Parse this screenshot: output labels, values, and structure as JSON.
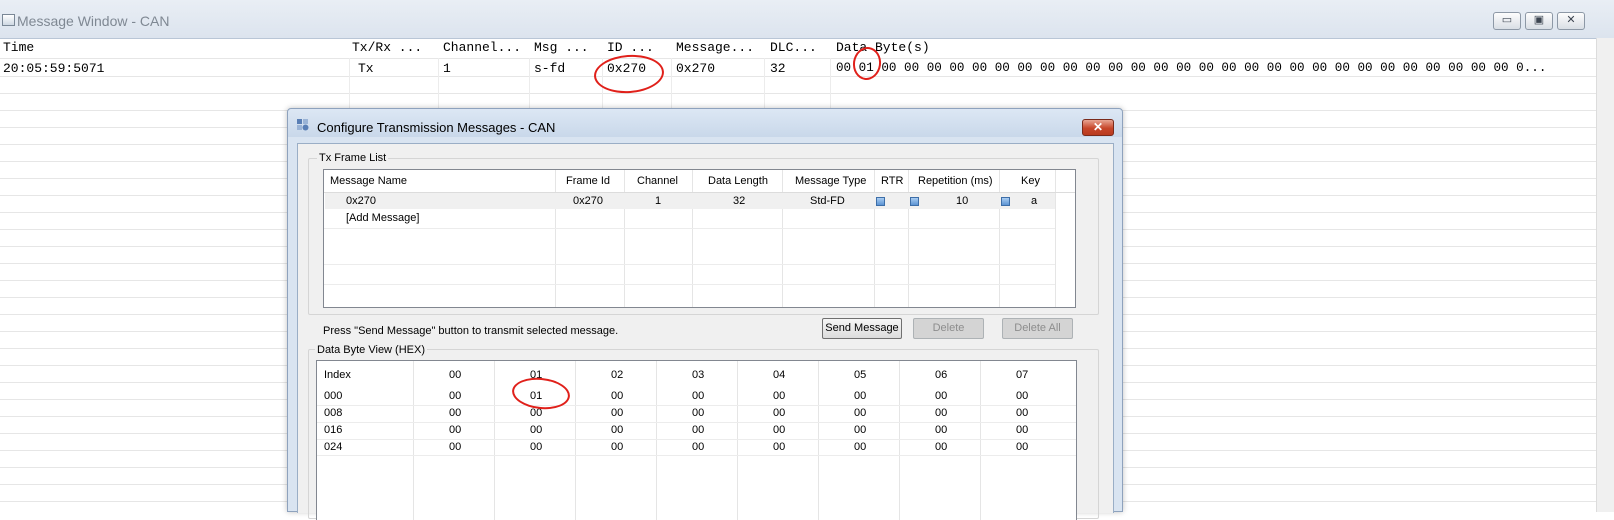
{
  "message_window": {
    "title": "Message Window - CAN",
    "buttons": {
      "minimize": "▭",
      "restore": "▣",
      "close": "✕"
    },
    "columns": [
      "Time",
      "Tx/Rx ...",
      "Channel...",
      "Msg ...",
      "ID  ...",
      "Message...",
      "DLC...",
      "Data Byte(s)"
    ],
    "row": {
      "time": "20:05:59:5071",
      "txrx": "Tx",
      "channel": "1",
      "msg_type": "s-fd",
      "id": "0x270",
      "message": "0x270",
      "dlc": "32",
      "data_bytes": "00 01 00 00 00 00 00 00 00 00 00 00 00 00 00 00 00 00 00 00 00 00 00 00 00 00 00 00 00 00 0..."
    }
  },
  "dialog": {
    "title": "Configure Transmission Messages - CAN",
    "close_label": "✕",
    "tx_frame_list": {
      "label": "Tx Frame List",
      "columns": [
        "Message Name",
        "Frame Id",
        "Channel",
        "Data Length",
        "Message Type",
        "RTR",
        "Repetition (ms)",
        "Key"
      ],
      "rows": [
        {
          "name": "0x270",
          "frame_id": "0x270",
          "channel": "1",
          "data_length": "32",
          "message_type": "Std-FD",
          "repetition": "10",
          "key": "a"
        }
      ],
      "add_message": "[Add Message]"
    },
    "hint": "Press \"Send Message\" button to transmit selected message.",
    "buttons": {
      "send": "Send Message",
      "delete": "Delete",
      "delete_all": "Delete All"
    },
    "data_byte_view": {
      "label": "Data Byte View (HEX)",
      "header": [
        "Index",
        "00",
        "01",
        "02",
        "03",
        "04",
        "05",
        "06",
        "07"
      ],
      "rows": [
        [
          "000",
          "00",
          "01",
          "00",
          "00",
          "00",
          "00",
          "00",
          "00"
        ],
        [
          "008",
          "00",
          "00",
          "00",
          "00",
          "00",
          "00",
          "00",
          "00"
        ],
        [
          "016",
          "00",
          "00",
          "00",
          "00",
          "00",
          "00",
          "00",
          "00"
        ],
        [
          "024",
          "00",
          "00",
          "00",
          "00",
          "00",
          "00",
          "00",
          "00"
        ]
      ]
    }
  },
  "colors": {
    "annotation": "#e0201a",
    "checkbox": "#5b93d3"
  }
}
